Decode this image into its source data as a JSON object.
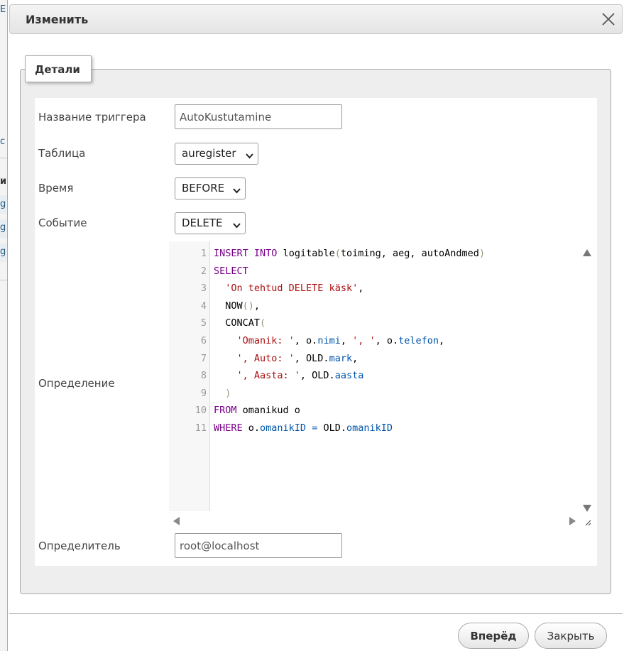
{
  "dialog": {
    "title": "Изменить",
    "tab": "Детали"
  },
  "form": {
    "trigger_name": {
      "label": "Название триггера",
      "value": "AutoKustutamine"
    },
    "table": {
      "label": "Таблица",
      "value": "auregister"
    },
    "time": {
      "label": "Время",
      "value": "BEFORE"
    },
    "event": {
      "label": "Событие",
      "value": "DELETE"
    },
    "definition": {
      "label": "Определение"
    },
    "definer": {
      "label": "Определитель",
      "value": "root@localhost"
    }
  },
  "code_lines": [
    {
      "n": "1",
      "tokens": [
        [
          "kw",
          "INSERT"
        ],
        [
          "plain",
          " "
        ],
        [
          "kw",
          "INTO"
        ],
        [
          "plain",
          " logitable"
        ],
        [
          "br",
          "("
        ],
        [
          "plain",
          "toiming, aeg, autoAndmed"
        ],
        [
          "br",
          ")"
        ]
      ]
    },
    {
      "n": "2",
      "tokens": [
        [
          "kw",
          "SELECT"
        ]
      ]
    },
    {
      "n": "3",
      "tokens": [
        [
          "plain",
          "  "
        ],
        [
          "str",
          "'On tehtud DELETE käsk'"
        ],
        [
          "plain",
          ","
        ]
      ]
    },
    {
      "n": "4",
      "tokens": [
        [
          "plain",
          "  NOW"
        ],
        [
          "br",
          "()"
        ],
        [
          "plain",
          ","
        ]
      ]
    },
    {
      "n": "5",
      "tokens": [
        [
          "plain",
          "  CONCAT"
        ],
        [
          "br",
          "("
        ]
      ]
    },
    {
      "n": "6",
      "tokens": [
        [
          "plain",
          "    "
        ],
        [
          "str",
          "'Omanik: '"
        ],
        [
          "plain",
          ", o."
        ],
        [
          "prop",
          "nimi"
        ],
        [
          "plain",
          ", "
        ],
        [
          "str",
          "', '"
        ],
        [
          "plain",
          ", o."
        ],
        [
          "prop",
          "telefon"
        ],
        [
          "plain",
          ","
        ]
      ]
    },
    {
      "n": "7",
      "tokens": [
        [
          "plain",
          "    "
        ],
        [
          "str",
          "', Auto: '"
        ],
        [
          "plain",
          ", OLD."
        ],
        [
          "prop",
          "mark"
        ],
        [
          "plain",
          ","
        ]
      ]
    },
    {
      "n": "8",
      "tokens": [
        [
          "plain",
          "    "
        ],
        [
          "str",
          "', Aasta: '"
        ],
        [
          "plain",
          ", OLD."
        ],
        [
          "prop",
          "aasta"
        ]
      ]
    },
    {
      "n": "9",
      "tokens": [
        [
          "plain",
          "  "
        ],
        [
          "br",
          ")"
        ]
      ]
    },
    {
      "n": "10",
      "tokens": [
        [
          "kw",
          "FROM"
        ],
        [
          "plain",
          " omanikud o"
        ]
      ]
    },
    {
      "n": "11",
      "tokens": [
        [
          "kw",
          "WHERE"
        ],
        [
          "plain",
          " o."
        ],
        [
          "prop",
          "omanikID"
        ],
        [
          "plain",
          " "
        ],
        [
          "prop",
          "="
        ],
        [
          "plain",
          " OLD."
        ],
        [
          "prop",
          "omanikID"
        ]
      ]
    }
  ],
  "buttons": {
    "go": "Вперёд",
    "close": "Закрыть"
  },
  "background": {
    "fragments": [
      "E",
      "c",
      "и",
      "g",
      "g",
      "g"
    ]
  },
  "colors": {
    "keyword": "#770088",
    "string": "#aa1111",
    "property": "#0055aa",
    "bracket": "#999977"
  }
}
